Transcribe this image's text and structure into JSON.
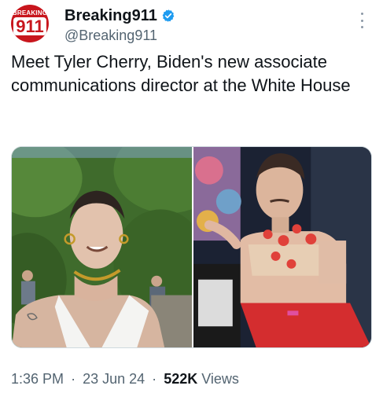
{
  "author": {
    "avatar_top_text": "BREAKING",
    "avatar_main_text": "911",
    "display_name": "Breaking911",
    "handle": "@Breaking911"
  },
  "tweet": {
    "text": "Meet Tyler Cherry, Biden's new associate communications director at the White House"
  },
  "media": {
    "photo_count": 2
  },
  "meta": {
    "time": "1:36 PM",
    "separator": "·",
    "date": "23 Jun 24",
    "views_count": "522K",
    "views_label": "Views"
  },
  "colors": {
    "verified_blue": "#1d9bf0",
    "avatar_red": "#c8161d",
    "secondary_text": "#536471"
  },
  "icons": {
    "verified": "verified-badge-icon",
    "more": "more-options-icon"
  }
}
